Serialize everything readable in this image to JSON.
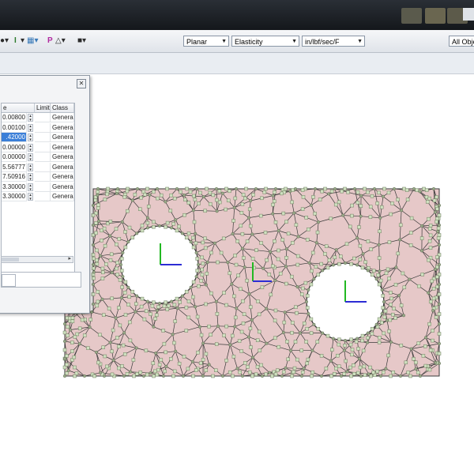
{
  "toolbar": {
    "items": [
      {
        "icon": "snap-icon",
        "label": ""
      },
      {
        "icon": "dimension-icon",
        "label": "I"
      },
      {
        "icon": "layer-icon",
        "label": ""
      },
      {
        "icon": "probe-icon",
        "label": "P"
      },
      {
        "icon": "node-icon",
        "label": ""
      },
      {
        "icon": "tool-icon",
        "label": ""
      }
    ],
    "analysis_mode": "Planar",
    "analysis_type": "Elasticity",
    "units": "in/lbf/sec/F",
    "object_filter": "All Obje"
  },
  "dialog": {
    "close_label": "✕",
    "columns": [
      "e",
      "Limit",
      "Class"
    ],
    "rows": [
      {
        "value": "0.00800",
        "limit": "",
        "class": "General",
        "selected": false
      },
      {
        "value": "0.00100",
        "limit": "",
        "class": "General",
        "selected": false
      },
      {
        "value": ".42000",
        "limit": "",
        "class": "General",
        "selected": true
      },
      {
        "value": "0.00000",
        "limit": "",
        "class": "General",
        "selected": false
      },
      {
        "value": "0.00000",
        "limit": "",
        "class": "General",
        "selected": false
      },
      {
        "value": "5.56777",
        "limit": "",
        "class": "General",
        "selected": false
      },
      {
        "value": "7.50916",
        "limit": "",
        "class": "General",
        "selected": false
      },
      {
        "value": "3.30000",
        "limit": "",
        "class": "General",
        "selected": false
      },
      {
        "value": "3.30000",
        "limit": "",
        "class": "General",
        "selected": false
      }
    ]
  },
  "model": {
    "fill_color": "#e6c8c8",
    "edge_color": "#3a3a3a",
    "node_color": "#cfe0c0",
    "axis_x_color": "#2c2cd4",
    "axis_y_color": "#22b822"
  }
}
